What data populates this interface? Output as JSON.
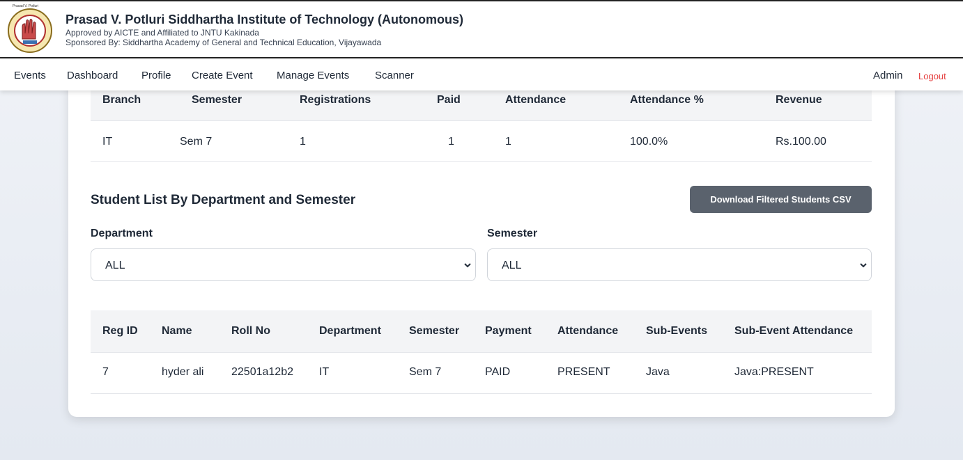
{
  "header": {
    "logo_text": "Prasad V. Potluri",
    "name": "Prasad V. Potluri Siddhartha Institute of Technology (Autonomous)",
    "line1": "Approved by AICTE and Affiliated to JNTU Kakinada",
    "line2": "Sponsored By: Siddhartha Academy of General and Technical Education, Vijayawada"
  },
  "nav": {
    "items": [
      "Events",
      "Dashboard",
      "Profile",
      "Create Event",
      "Manage Events",
      "Scanner"
    ],
    "admin": "Admin",
    "logout": "Logout"
  },
  "summary": {
    "headers": [
      "Branch",
      "Semester",
      "Registrations",
      "Paid",
      "Attendance",
      "Attendance %",
      "Revenue"
    ],
    "rows": [
      [
        "IT",
        "Sem 7",
        "1",
        "1",
        "1",
        "100.0%",
        "Rs.100.00"
      ]
    ]
  },
  "student_list": {
    "title": "Student List By Department and Semester",
    "download_label": "Download Filtered Students CSV",
    "department_label": "Department",
    "department_value": "ALL",
    "semester_label": "Semester",
    "semester_value": "ALL",
    "headers": [
      "Reg ID",
      "Name",
      "Roll No",
      "Department",
      "Semester",
      "Payment",
      "Attendance",
      "Sub-Events",
      "Sub-Event Attendance"
    ],
    "rows": [
      [
        "7",
        "hyder ali",
        "22501a12b2",
        "IT",
        "Sem 7",
        "PAID",
        "PRESENT",
        "Java",
        "Java:PRESENT"
      ]
    ]
  },
  "colors": {
    "logout": "#e53e3e",
    "button": "#5a626d",
    "table_header_bg": "#f3f4f6"
  }
}
